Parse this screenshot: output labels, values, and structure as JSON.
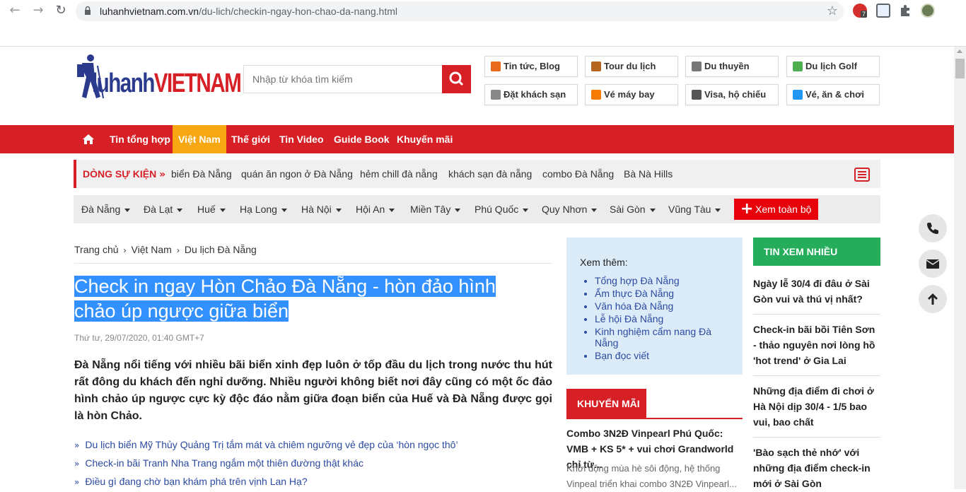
{
  "browser": {
    "url_domain": "luhanhvietnam.com.vn",
    "url_path": "/du-lich/checkin-ngay-hon-chao-da-nang.html",
    "ext_badge": "7"
  },
  "header": {
    "logo_text_left": "luhanh",
    "logo_text_right": "VIETNAM",
    "search_placeholder": "Nhập từ khóa tìm kiếm",
    "quick_links": [
      {
        "label": "Tin tức, Blog",
        "icon": "news-icon",
        "color": "#e86a1e"
      },
      {
        "label": "Tour du lịch",
        "icon": "suitcase-icon",
        "color": "#b5651d"
      },
      {
        "label": "Du thuyền",
        "icon": "cruise-icon",
        "color": "#777777"
      },
      {
        "label": "Du lịch Golf",
        "icon": "golf-icon",
        "color": "#4caf50"
      },
      {
        "label": "Đặt khách sạn",
        "icon": "hotel-icon",
        "color": "#888888"
      },
      {
        "label": "Vé máy bay",
        "icon": "plane-icon",
        "color": "#f57c00"
      },
      {
        "label": "Visa, hộ chiếu",
        "icon": "visa-icon",
        "color": "#555555"
      },
      {
        "label": "Vé, ăn & chơi",
        "icon": "bus-icon",
        "color": "#2196f3"
      }
    ]
  },
  "nav": {
    "items": [
      "Tin tổng hợp",
      "Việt Nam",
      "Thế giới",
      "Tin Video",
      "Guide Book",
      "Khuyến mãi"
    ],
    "active": "Việt Nam"
  },
  "events": {
    "label": "DÒNG SỰ KIỆN",
    "items": [
      "biển Đà Nẵng",
      "quán ăn ngon ở Đà Nẵng",
      "hẻm chill đà nẵng",
      "khách sạn đà nẵng",
      "combo Đà Nẵng",
      "Bà Nà Hills"
    ]
  },
  "locations": {
    "items": [
      "Đà Nẵng",
      "Đà Lạt",
      "Huế",
      "Hạ Long",
      "Hà Nội",
      "Hội An",
      "Miền Tây",
      "Phú Quốc",
      "Quy Nhơn",
      "Sài Gòn",
      "Vũng Tàu"
    ],
    "more_label": "Xem toàn bộ"
  },
  "breadcrumb": [
    "Trang chủ",
    "Việt Nam",
    "Du lịch Đà Nẵng"
  ],
  "article": {
    "title_line1": "Check in ngay Hòn Chảo Đà Nẵng - hòn đảo hình",
    "title_line2": "chảo úp ngược giữa biển",
    "date": "Thứ tư, 29/07/2020, 01:40 GMT+7",
    "lead": "Đà Nẵng nổi tiếng với nhiều bãi biển xinh đẹp luôn ở tốp đầu du lịch trong nước thu hút rất đông du khách đến nghỉ dưỡng. Nhiều người không biết nơi đây cũng có một ốc đảo hình chảo úp ngược cực kỳ độc đáo nằm giữa đoạn biển của Huế và Đà Nẵng được gọi là hòn Chảo.",
    "related": [
      "Du lịch biển Mỹ Thủy Quảng Trị tắm mát và chiêm ngưỡng vẻ đẹp của ‘hòn ngọc thô’",
      "Check-in bãi Tranh Nha Trang ngắm một thiên đường thật khác",
      "Điều gì đang chờ bạn khám phá trên vịnh Lan Hạ?"
    ]
  },
  "see_more": {
    "heading": "Xem thêm:",
    "items": [
      "Tổng hợp Đà Nẵng",
      "Ẩm thực Đà Nẵng",
      "Văn hóa Đà Nẵng",
      "Lễ hội Đà Nẵng",
      "Kinh nghiệm cẩm nang Đà Nẵng",
      "Bạn đọc viết"
    ]
  },
  "promo": {
    "tab": "KHUYẾN MÃI",
    "title": "Combo 3N2Đ Vinpearl Phú Quốc: VMB + KS 5* + vui chơi Grandworld chỉ từ...",
    "desc": "Khởi động mùa hè sôi động, hệ thống Vinpeal triển khai combo 3N2Đ Vinpearl..."
  },
  "most_read": {
    "heading": "TIN XEM NHIỀU",
    "items": [
      "Ngày lễ 30/4 đi đâu ở Sài Gòn vui và thú vị nhất?",
      "Check-in bãi bồi Tiên Sơn - thảo nguyên nơi lòng hồ 'hot trend' ở Gia Lai",
      "Những địa điểm đi chơi ở Hà Nội dịp 30/4 - 1/5 bao vui, bao chất",
      "'Bào sạch thẻ nhớ' với những địa điểm check-in mới ở Sài Gòn"
    ]
  },
  "colors": {
    "brand_red": "#d71f26",
    "nav_active": "#f6a712",
    "green": "#25ad5c",
    "selection": "#3390ff"
  }
}
